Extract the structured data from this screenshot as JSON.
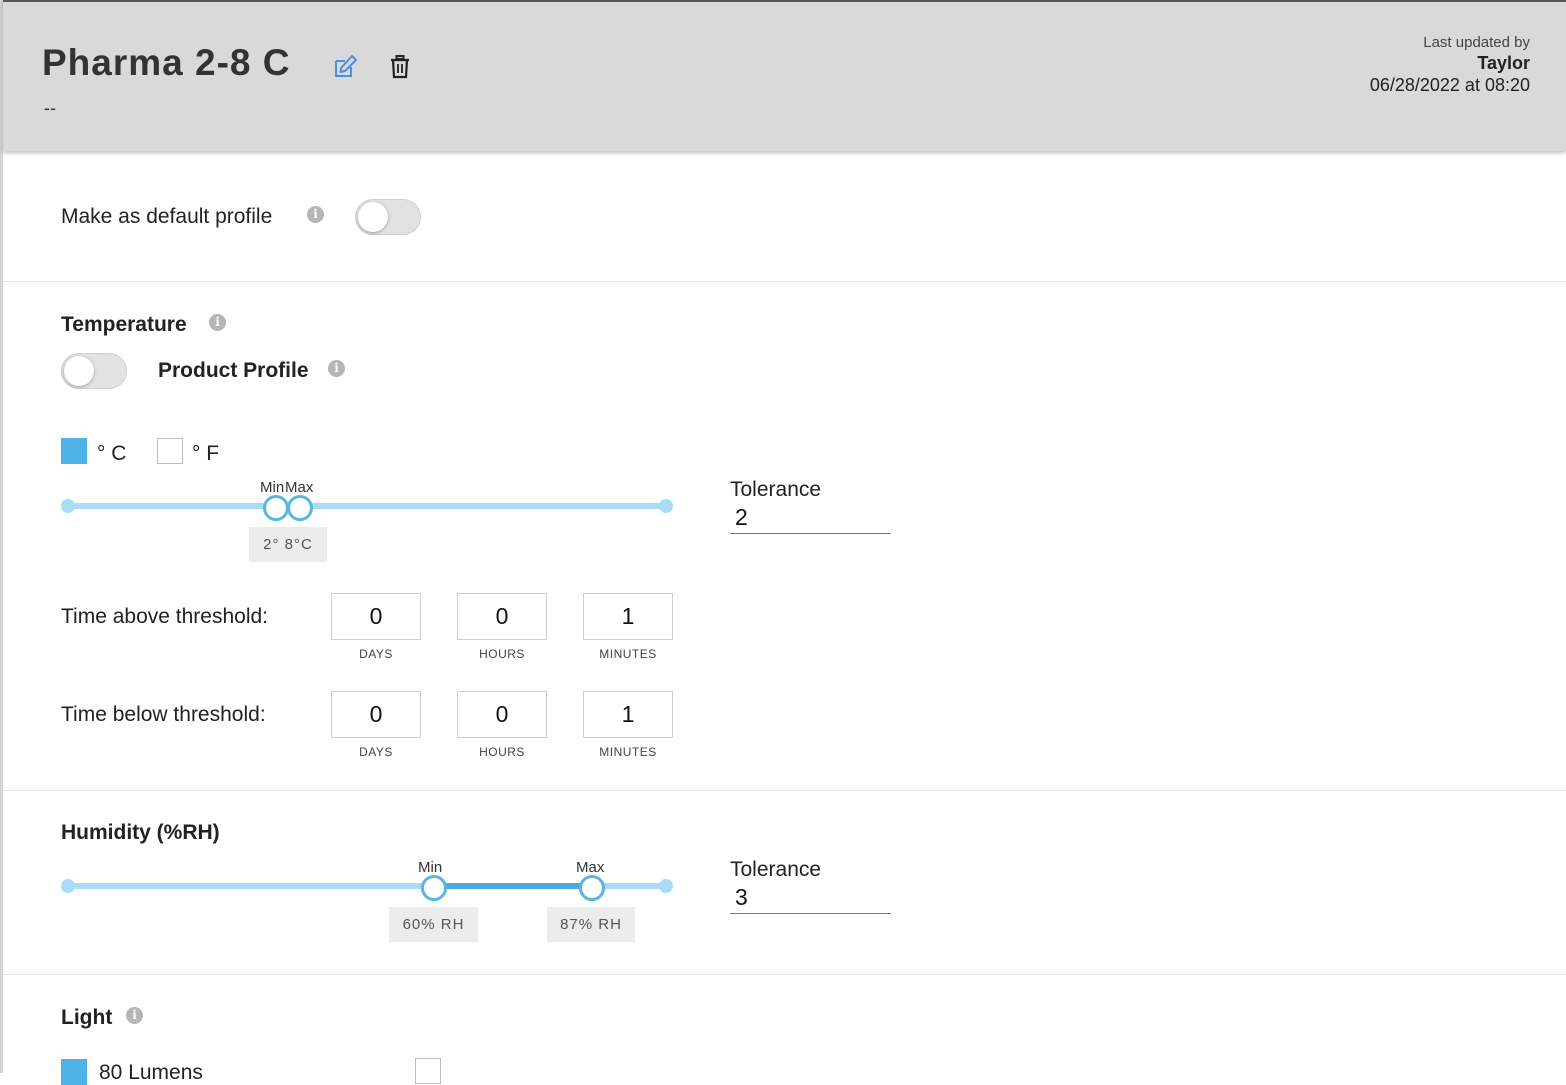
{
  "header": {
    "title": "Pharma 2-8 C",
    "subtitle": "--",
    "last_updated_label": "Last updated by",
    "last_updated_user": "Taylor",
    "last_updated_date": "06/28/2022 at 08:20"
  },
  "default_profile": {
    "label": "Make as default profile",
    "enabled": false
  },
  "temperature": {
    "heading": "Temperature",
    "product_profile_label": "Product Profile",
    "product_profile_enabled": false,
    "units": [
      {
        "label": "° C",
        "checked": true
      },
      {
        "label": "° F",
        "checked": false
      }
    ],
    "slider": {
      "min_label": "Min",
      "max_label": "Max",
      "min_value": 2,
      "max_value": 8,
      "value_text": "2° 8°C"
    },
    "tolerance_label": "Tolerance",
    "tolerance_value": "2",
    "time_above": {
      "label": "Time above threshold:",
      "days": "0",
      "hours": "0",
      "minutes": "1"
    },
    "time_below": {
      "label": "Time below threshold:",
      "days": "0",
      "hours": "0",
      "minutes": "1"
    },
    "unit_days": "DAYS",
    "unit_hours": "HOURS",
    "unit_minutes": "MINUTES"
  },
  "humidity": {
    "heading": "Humidity (%RH)",
    "slider": {
      "min_label": "Min",
      "max_label": "Max",
      "min_value": 60,
      "max_value": 87,
      "min_text": "60% RH",
      "max_text": "87% RH"
    },
    "tolerance_label": "Tolerance",
    "tolerance_value": "3"
  },
  "light": {
    "heading": "Light",
    "option_label": "80 Lumens",
    "option_checked": true,
    "second_checked": false
  },
  "colors": {
    "accent": "#4fb3e8",
    "track": "#a8dcf6",
    "header_bg": "#d9d9d9"
  },
  "icons": [
    "edit-icon",
    "delete-icon",
    "info-icon"
  ]
}
